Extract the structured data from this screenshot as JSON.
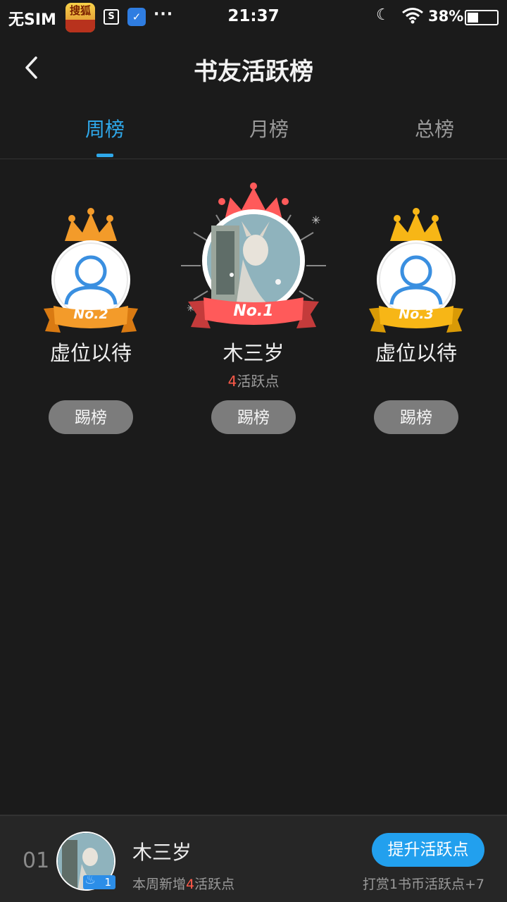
{
  "status_bar": {
    "carrier": "无SIM",
    "app1_label": "搜狐",
    "app2_label": "S",
    "more": "···",
    "time": "21:37",
    "battery": "38%",
    "battery_level": 0.38
  },
  "header": {
    "title": "书友活跃榜"
  },
  "tabs": [
    {
      "label": "周榜",
      "active": true
    },
    {
      "label": "月榜",
      "active": false
    },
    {
      "label": "总榜",
      "active": false
    }
  ],
  "podium": {
    "first": {
      "rank_label": "No.1",
      "name": "木三岁",
      "points_value": "4",
      "points_suffix": "活跃点",
      "button": "踢榜"
    },
    "second": {
      "rank_label": "No.2",
      "name": "虚位以待",
      "button": "踢榜"
    },
    "third": {
      "rank_label": "No.3",
      "name": "虚位以待",
      "button": "踢榜"
    }
  },
  "colors": {
    "accent": "#2fa8ea",
    "gold_first": "#ff5a5a",
    "orange_second": "#f39b2a",
    "yellow_third": "#f7b616",
    "highlight_number": "#ff5a49"
  },
  "my_rank": {
    "rank": "01",
    "name": "木三岁",
    "level": "1",
    "weekly_prefix": "本周新增",
    "weekly_value": "4",
    "weekly_suffix": "活跃点",
    "boost_button": "提升活跃点",
    "reward_note": "打赏1书币活跃点+7"
  }
}
